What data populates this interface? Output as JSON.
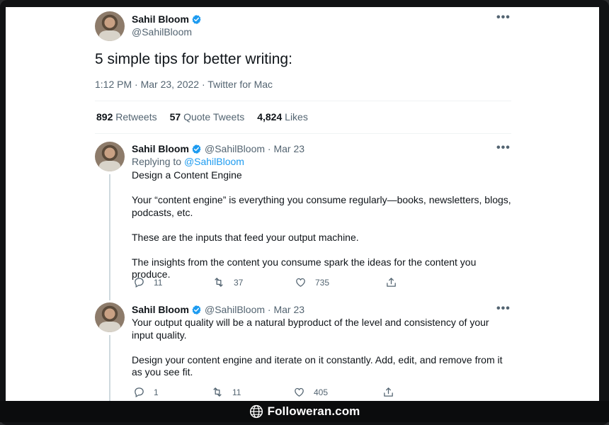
{
  "tweet": {
    "author_name": "Sahil Bloom",
    "author_handle": "@SahilBloom",
    "text": "5 simple tips for better writing:",
    "meta": "1:12 PM · Mar 23, 2022 · Twitter for Mac",
    "retweets_count": "892",
    "retweets_label": "Retweets",
    "quote_count": "57",
    "quote_label": "Quote Tweets",
    "likes_count": "4,824",
    "likes_label": "Likes"
  },
  "replies": [
    {
      "name": "Sahil Bloom",
      "handle_date": "@SahilBloom · Mar 23",
      "replying_prefix": "Replying to",
      "replying_to": "@SahilBloom",
      "paragraphs": [
        "Design a Content Engine",
        "Your “content engine” is everything you consume regularly—books, newsletters, blogs, podcasts, etc.",
        "These are the inputs that feed your output machine.",
        "The insights from the content you consume spark the ideas for the content you produce."
      ],
      "replies": "11",
      "retweets": "37",
      "likes": "735"
    },
    {
      "name": "Sahil Bloom",
      "handle_date": "@SahilBloom · Mar 23",
      "paragraphs": [
        "Your output quality will be a natural byproduct of the level and consistency of your input quality.",
        "Design your content engine and iterate on it constantly. Add, edit, and remove from it as you see fit."
      ],
      "replies": "1",
      "retweets": "11",
      "likes": "405"
    }
  ],
  "footer": {
    "brand": "Followeran.com"
  },
  "icons": {
    "verified": "verified-badge-icon",
    "more": "more-options-icon",
    "reply": "reply-icon",
    "retweet": "retweet-icon",
    "like": "heart-icon",
    "share": "share-icon",
    "globe": "globe-icon"
  },
  "colors": {
    "accent": "#1d9bf0",
    "muted": "#536471",
    "text": "#0f1419"
  }
}
